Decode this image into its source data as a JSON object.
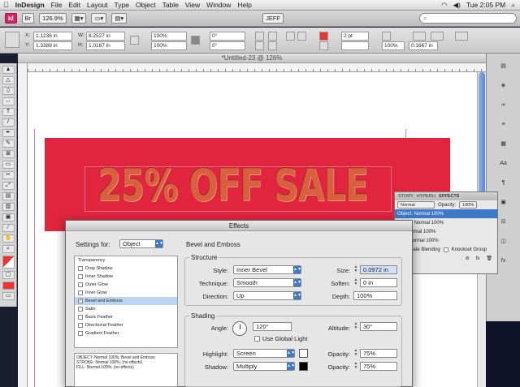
{
  "menubar": {
    "apple": "",
    "app_name": "InDesign",
    "menus": [
      "File",
      "Edit",
      "Layout",
      "Type",
      "Object",
      "Table",
      "View",
      "Window",
      "Help"
    ],
    "clock": "Tue 2:05 PM"
  },
  "appbar": {
    "zoom": "126.9%",
    "workspace": "JEFF",
    "search_placeholder": ""
  },
  "control": {
    "x_label": "X:",
    "x_value": "1.1236 in",
    "y_label": "Y:",
    "y_value": "1.3389 in",
    "w_label": "W:",
    "w_value": "8.2527 in",
    "h_label": "H:",
    "h_value": "1.0167 in",
    "scale_x": "100%",
    "scale_y": "100%",
    "rotate": "0°",
    "shear": "0°",
    "stroke_weight": "2 pt",
    "opacity": "100%",
    "measure": "0.1667 in"
  },
  "document": {
    "title": "*Untitled-23 @ 126%",
    "headline": "25% OFF SALE"
  },
  "dock": {
    "items": [
      "",
      "",
      "",
      "",
      "",
      "Aa",
      "",
      "",
      "",
      "",
      "fx"
    ]
  },
  "fx_panel": {
    "tabs": [
      "STORY",
      "HYPERLI",
      "EFFECTS"
    ],
    "blend_mode": "Normal",
    "opacity_label": "Opacity:",
    "opacity_value": "100%",
    "rows": [
      "Object: Normal 100%",
      "Stroke: Normal 100%",
      "Fill: Normal 100%",
      "Text: Normal 100%"
    ],
    "isolate": "Isolate Blending",
    "knockout": "Knockout Group"
  },
  "dialog": {
    "title": "Effects",
    "settings_for_label": "Settings for:",
    "settings_for_value": "Object",
    "section_title": "Bevel and Emboss",
    "effects_list": [
      {
        "label": "Transparency",
        "checked": false,
        "header": true
      },
      {
        "label": "Drop Shadow",
        "checked": false
      },
      {
        "label": "Inner Shadow",
        "checked": false
      },
      {
        "label": "Outer Glow",
        "checked": false
      },
      {
        "label": "Inner Glow",
        "checked": false
      },
      {
        "label": "Bevel and Emboss",
        "checked": true,
        "selected": true
      },
      {
        "label": "Satin",
        "checked": false
      },
      {
        "label": "Basic Feather",
        "checked": false
      },
      {
        "label": "Directional Feather",
        "checked": false
      },
      {
        "label": "Gradient Feather",
        "checked": false
      }
    ],
    "summary": "OBJECT: Normal 100%; Bevel and Emboss\nSTROKE: Normal 100%; (no effects)\nFILL: Normal 100%; (no effects)",
    "structure": {
      "title": "Structure",
      "style_label": "Style:",
      "style_value": "Inner Bevel",
      "technique_label": "Technique:",
      "technique_value": "Smooth",
      "direction_label": "Direction:",
      "direction_value": "Up",
      "size_label": "Size:",
      "size_value": "0.0972 in",
      "soften_label": "Soften:",
      "soften_value": "0 in",
      "depth_label": "Depth:",
      "depth_value": "100%"
    },
    "shading": {
      "title": "Shading",
      "angle_label": "Angle:",
      "angle_value": "120°",
      "global_light_label": "Use Global Light",
      "altitude_label": "Altitude:",
      "altitude_value": "30°",
      "highlight_label": "Highlight:",
      "highlight_value": "Screen",
      "highlight_color": "#ffffff",
      "highlight_opacity_label": "Opacity:",
      "highlight_opacity_value": "75%",
      "shadow_label": "Shadow:",
      "shadow_value": "Multiply",
      "shadow_color": "#000000",
      "shadow_opacity_label": "Opacity:",
      "shadow_opacity_value": "75%"
    }
  }
}
